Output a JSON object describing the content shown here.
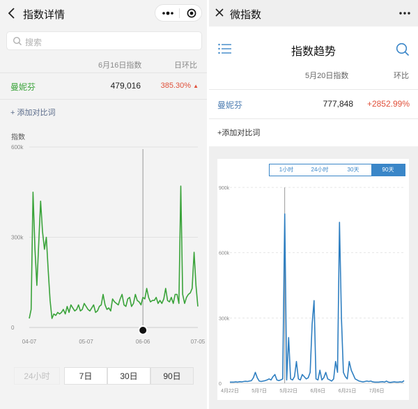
{
  "left": {
    "title": "指数详情",
    "search_placeholder": "搜索",
    "col_index": "6月16日指数",
    "col_change": "日环比",
    "row": {
      "name": "曼妮芬",
      "value": "479,016",
      "change": "385.30%"
    },
    "add_compare": "+ 添加对比词",
    "y_axis_title": "指数",
    "ranges": [
      {
        "label": "24小时",
        "state": "disabled"
      },
      {
        "label": "7日",
        "state": "normal"
      },
      {
        "label": "30日",
        "state": "normal"
      },
      {
        "label": "90日",
        "state": "active"
      }
    ]
  },
  "right": {
    "title": "微指数",
    "heading": "指数趋势",
    "col_index": "5月20日指数",
    "col_change": "环比",
    "row": {
      "name": "曼妮芬",
      "value": "777,848",
      "change": "+2852.99%"
    },
    "add_compare": "+添加对比词",
    "ranges": [
      {
        "label": "1小时",
        "state": "normal"
      },
      {
        "label": "24小时",
        "state": "normal"
      },
      {
        "label": "30天",
        "state": "normal"
      },
      {
        "label": "90天",
        "state": "active"
      }
    ]
  },
  "colors": {
    "green": "#3aa33a",
    "blue": "#2f7fc1",
    "red": "#e0503a"
  },
  "chart_data": [
    {
      "type": "line",
      "ylabel": "指数",
      "yticks": [
        "600k",
        "300k",
        "0"
      ],
      "ytick_values": [
        600000,
        300000,
        0
      ],
      "ylim": [
        0,
        600000
      ],
      "xticks": [
        "04-07",
        "05-07",
        "06-06",
        "07-05"
      ],
      "xtick_positions": [
        0,
        30,
        60,
        89
      ],
      "series": [
        {
          "color": "#3aa33a",
          "x": [
            0,
            1,
            2,
            3,
            4,
            5,
            6,
            7,
            8,
            9,
            10,
            11,
            12,
            13,
            14,
            15,
            16,
            17,
            18,
            19,
            20,
            21,
            22,
            23,
            24,
            25,
            26,
            27,
            28,
            29,
            30,
            31,
            32,
            33,
            34,
            35,
            36,
            37,
            38,
            39,
            40,
            41,
            42,
            43,
            44,
            45,
            46,
            47,
            48,
            49,
            50,
            51,
            52,
            53,
            54,
            55,
            56,
            57,
            58,
            59,
            60,
            61,
            62,
            63,
            64,
            65,
            66,
            67,
            68,
            69,
            70,
            71,
            72,
            73,
            74,
            75,
            76,
            77,
            78,
            79,
            80,
            81,
            82,
            83,
            84,
            85,
            86,
            87,
            88,
            89
          ],
          "values": [
            30000,
            60000,
            450000,
            260000,
            140000,
            280000,
            420000,
            320000,
            260000,
            300000,
            190000,
            90000,
            30000,
            45000,
            40000,
            50000,
            45000,
            50000,
            60000,
            45000,
            70000,
            50000,
            75000,
            65000,
            55000,
            60000,
            75000,
            55000,
            60000,
            80000,
            70000,
            60000,
            55000,
            65000,
            75000,
            50000,
            55000,
            70000,
            75000,
            110000,
            75000,
            60000,
            65000,
            55000,
            95000,
            85000,
            80000,
            75000,
            95000,
            110000,
            75000,
            70000,
            95000,
            100000,
            70000,
            80000,
            110000,
            90000,
            85000,
            75000,
            100000,
            95000,
            130000,
            100000,
            85000,
            90000,
            90000,
            100000,
            80000,
            90000,
            80000,
            95000,
            130000,
            90000,
            85000,
            100000,
            80000,
            110000,
            110000,
            80000,
            470000,
            110000,
            80000,
            100000,
            110000,
            115000,
            130000,
            250000,
            140000,
            70000
          ],
          "marker_index": 60
        }
      ]
    },
    {
      "type": "line",
      "yticks": [
        "900k",
        "600k",
        "300k",
        "0"
      ],
      "ytick_values": [
        900000,
        600000,
        300000,
        0
      ],
      "ylim": [
        0,
        900000
      ],
      "xticks": [
        "4月22日",
        "5月7日",
        "5月22日",
        "6月6日",
        "6月21日",
        "7月6日"
      ],
      "xtick_positions": [
        0,
        15,
        30,
        45,
        60,
        75
      ],
      "series": [
        {
          "color": "#2f7fc1",
          "x": [
            0,
            1,
            2,
            3,
            4,
            5,
            6,
            7,
            8,
            9,
            10,
            11,
            12,
            13,
            14,
            15,
            16,
            17,
            18,
            19,
            20,
            21,
            22,
            23,
            24,
            25,
            26,
            27,
            28,
            29,
            30,
            31,
            32,
            33,
            34,
            35,
            36,
            37,
            38,
            39,
            40,
            41,
            42,
            43,
            44,
            45,
            46,
            47,
            48,
            49,
            50,
            51,
            52,
            53,
            54,
            55,
            56,
            57,
            58,
            59,
            60,
            61,
            62,
            63,
            64,
            65,
            66,
            67,
            68,
            69,
            70,
            71,
            72,
            73,
            74,
            75,
            76,
            77,
            78,
            79,
            80,
            81,
            82,
            83,
            84,
            85,
            86,
            87,
            88,
            89
          ],
          "values": [
            5000,
            5000,
            5000,
            6000,
            5000,
            7000,
            6000,
            8000,
            9000,
            8000,
            10000,
            12000,
            25000,
            50000,
            25000,
            10000,
            8000,
            10000,
            12000,
            15000,
            20000,
            15000,
            30000,
            40000,
            15000,
            12000,
            15000,
            20000,
            777848,
            15000,
            210000,
            20000,
            15000,
            30000,
            100000,
            20000,
            15000,
            40000,
            30000,
            20000,
            25000,
            50000,
            270000,
            380000,
            20000,
            15000,
            60000,
            15000,
            25000,
            50000,
            20000,
            15000,
            10000,
            20000,
            100000,
            50000,
            740000,
            300000,
            50000,
            30000,
            20000,
            100000,
            60000,
            40000,
            20000,
            15000,
            10000,
            8000,
            6000,
            8000,
            10000,
            8000,
            10000,
            6000,
            5000,
            5000,
            5000,
            6000,
            7000,
            5000,
            10000,
            5000,
            4000,
            5000,
            6000,
            5000,
            5000,
            6000,
            5000,
            12000
          ],
          "marker_index": 28
        }
      ]
    }
  ]
}
